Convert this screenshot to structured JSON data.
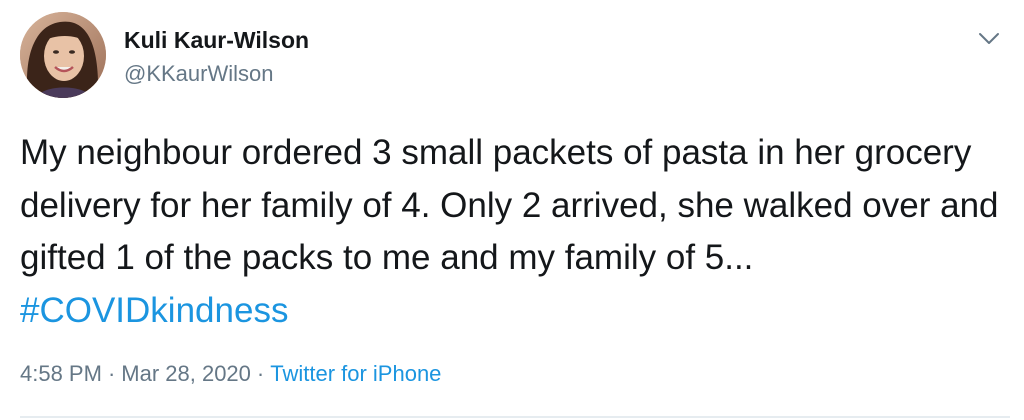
{
  "tweet": {
    "author_name": "Kuli Kaur-Wilson",
    "author_handle": "@KKaurWilson",
    "text": "My neighbour ordered 3 small packets of pasta in her grocery delivery for her family of 4. Only 2 arrived, she walked over and gifted 1 of the packs to me and my family of 5...",
    "hashtag": "#COVIDkindness",
    "time": "4:58 PM",
    "separator": "·",
    "date": "Mar 28, 2020",
    "source": "Twitter for iPhone"
  },
  "icons": {
    "avatar": "profile-photo",
    "menu": "chevron-down-icon"
  },
  "colors": {
    "text": "#14171a",
    "secondary": "#657786",
    "link": "#1b95e0",
    "divider": "#e6ecf0"
  }
}
